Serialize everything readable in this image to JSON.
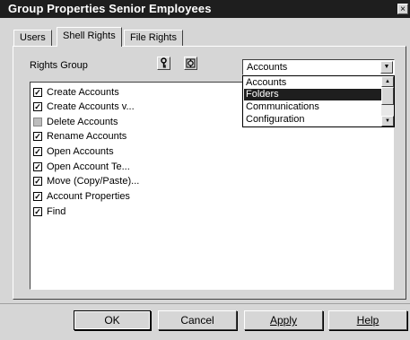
{
  "window": {
    "title": "Group Properties Senior Employees",
    "close_glyph": "×"
  },
  "tabs": [
    {
      "label": "Users",
      "active": false
    },
    {
      "label": "Shell Rights",
      "active": true
    },
    {
      "label": "File Rights",
      "active": false
    }
  ],
  "rights_group": {
    "label": "Rights Group",
    "icons": [
      "key-icon",
      "wrench-icon"
    ],
    "selected": "Accounts",
    "options": [
      "Accounts",
      "Folders",
      "Communications",
      "Configuration"
    ],
    "highlighted_option": "Folders"
  },
  "rights": [
    {
      "label": "Create Accounts",
      "checked": true,
      "enabled": true
    },
    {
      "label": "Create Accounts v...",
      "checked": true,
      "enabled": true
    },
    {
      "label": "Delete Accounts",
      "checked": false,
      "enabled": false
    },
    {
      "label": "Rename Accounts",
      "checked": true,
      "enabled": true
    },
    {
      "label": "Open Accounts",
      "checked": true,
      "enabled": true
    },
    {
      "label": "Open Account Te...",
      "checked": true,
      "enabled": true
    },
    {
      "label": "Move (Copy/Paste)...",
      "checked": true,
      "enabled": true
    },
    {
      "label": "Account Properties",
      "checked": true,
      "enabled": true
    },
    {
      "label": "Find",
      "checked": true,
      "enabled": true
    }
  ],
  "buttons": {
    "ok": "OK",
    "cancel": "Cancel",
    "apply": "Apply",
    "help": "Help"
  },
  "colors": {
    "titlebar": "#1e1e1e",
    "face": "#d6d6d6",
    "highlight": "#1e1e1e"
  }
}
